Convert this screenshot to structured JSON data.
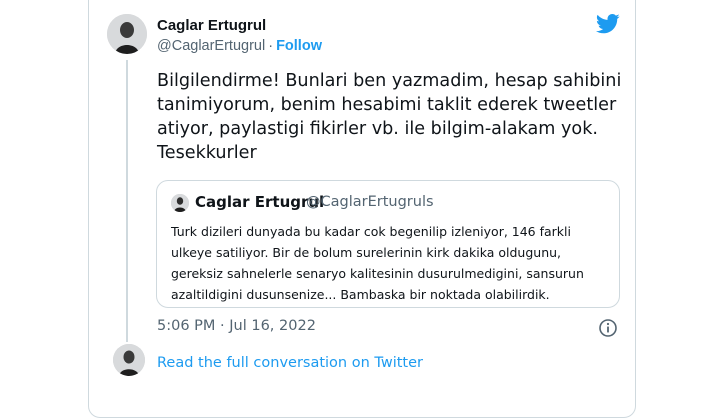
{
  "tweet": {
    "author_name": "Caglar Ertugrul",
    "author_handle": "@CaglarErtugrul",
    "separator": "·",
    "follow_label": "Follow",
    "text": "Bilgilendirme! Bunlari ben yazmadim, hesap sahibini\ntanimiyorum, benim hesabimi taklit ederek tweetler\natiyor, paylastigi fikirler vb. ile bilgim-alakam yok.\nTesekkurler",
    "timestamp": "5:06 PM · Jul 16, 2022"
  },
  "quoted_tweet": {
    "author_name": "Caglar Ertugrul",
    "author_handle": "@CaglarErtugruls",
    "text": "Turk dizileri dunyada bu kadar cok begenilip izleniyor, 146 farkli\nulkeye satiliyor. Bir de bolum surelerinin kirk dakika oldugunu,\ngereksiz sahnelerle senaryo kalitesinin dusurulmedigini, sansurun\nazaltildigini dusunsenize... Bambaska bir noktada olabilirdik."
  },
  "footer": {
    "read_more_label": "Read the full conversation on Twitter"
  },
  "icons": {
    "brand": "twitter-bird-icon",
    "info": "info-icon"
  },
  "colors": {
    "accent": "#1d9bf0",
    "text": "#0f1419",
    "muted": "#536471",
    "border": "#cfd9de"
  }
}
